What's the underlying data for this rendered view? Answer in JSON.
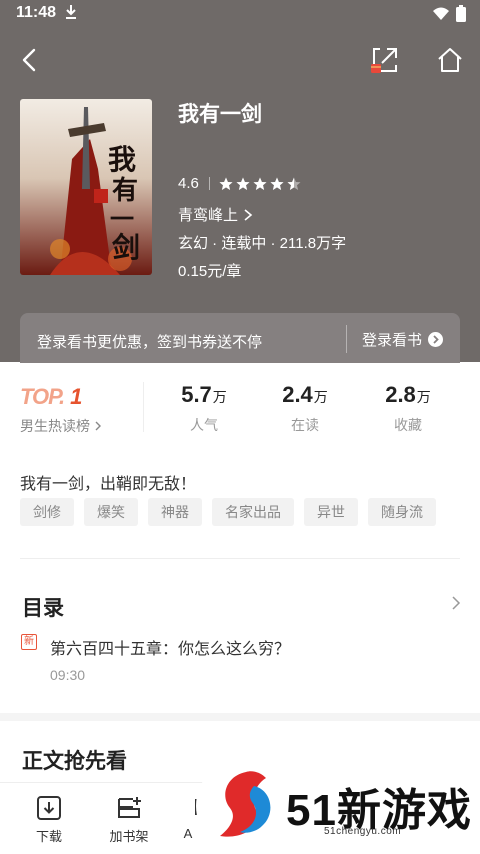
{
  "status": {
    "time": "11:48"
  },
  "book": {
    "title": "我有一剑",
    "rating": "4.6",
    "stars_filled": 4.5,
    "author": "青鸾峰上",
    "meta": "玄幻 · 连载中 · 211.8万字",
    "price": "0.15元/章",
    "cover_text": "我有一剑"
  },
  "login_bar": {
    "text": "登录看书更优惠，签到书券送不停",
    "button": "登录看书"
  },
  "rank": {
    "top_label": "TOP.",
    "top_number": "1",
    "list_name": "男生热读榜"
  },
  "stats": [
    {
      "value": "5.7",
      "unit": "万",
      "label": "人气"
    },
    {
      "value": "2.4",
      "unit": "万",
      "label": "在读"
    },
    {
      "value": "2.8",
      "unit": "万",
      "label": "收藏"
    }
  ],
  "intro": "我有一剑，出鞘即无敌！",
  "tags": [
    "剑修",
    "爆笑",
    "神器",
    "名家出品",
    "异世",
    "随身流"
  ],
  "toc": {
    "title": "目录",
    "new_badge": "新",
    "latest_chapter": "第六百四十五章：你怎么这么穷？",
    "update_time": "09:30"
  },
  "preview_title": "正文抢先看",
  "bottom_bar": {
    "download": "下载",
    "add_shelf": "加书架",
    "third_partial": "A"
  },
  "watermark": {
    "brand": "51新游戏",
    "domain": "51chengyu.com"
  },
  "colors": {
    "hero_bg": "#6f6a68",
    "accent": "#e6532e"
  }
}
